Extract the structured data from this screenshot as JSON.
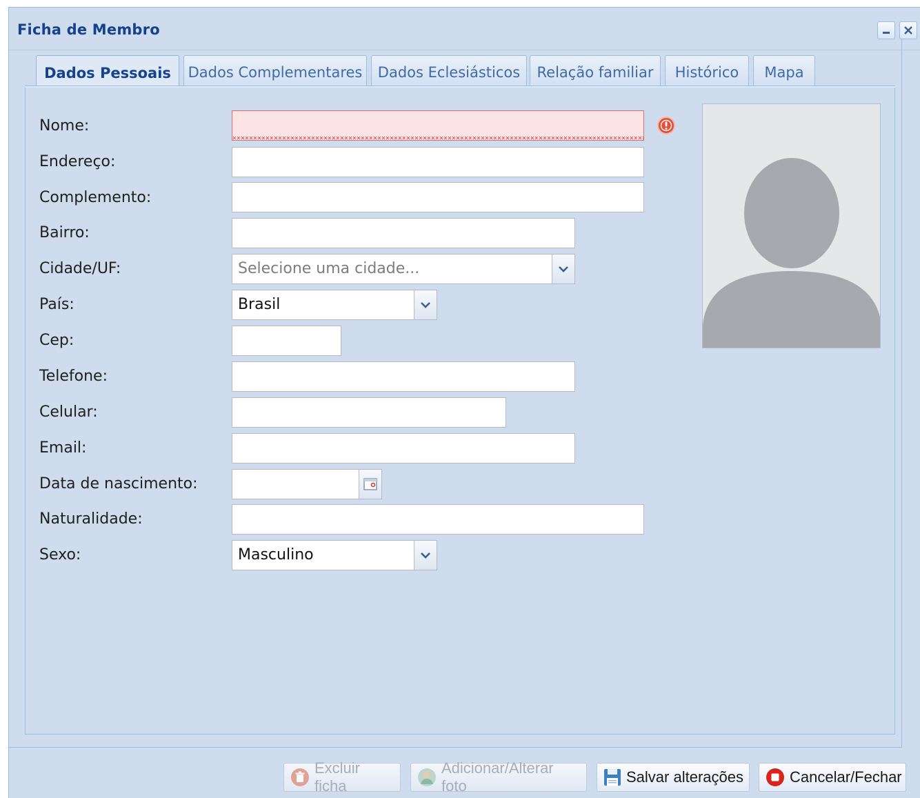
{
  "window": {
    "title": "Ficha de Membro"
  },
  "tabs": [
    {
      "label": "Dados Pessoais",
      "active": true
    },
    {
      "label": "Dados Complementares",
      "active": false
    },
    {
      "label": "Dados Eclesiásticos",
      "active": false
    },
    {
      "label": "Relação familiar",
      "active": false
    },
    {
      "label": "Histórico",
      "active": false
    },
    {
      "label": "Mapa",
      "active": false
    }
  ],
  "form": {
    "nome": {
      "label": "Nome:",
      "value": "",
      "invalid": true
    },
    "endereco": {
      "label": "Endereço:",
      "value": ""
    },
    "complemento": {
      "label": "Complemento:",
      "value": ""
    },
    "bairro": {
      "label": "Bairro:",
      "value": ""
    },
    "cidade": {
      "label": "Cidade/UF:",
      "placeholder": "Selecione uma cidade..."
    },
    "pais": {
      "label": "País:",
      "value": "Brasil"
    },
    "cep": {
      "label": "Cep:",
      "value": ""
    },
    "telefone": {
      "label": "Telefone:",
      "value": ""
    },
    "celular": {
      "label": "Celular:",
      "value": ""
    },
    "email": {
      "label": "Email:",
      "value": ""
    },
    "nascimento": {
      "label": "Data de nascimento:",
      "value": ""
    },
    "naturalidade": {
      "label": "Naturalidade:",
      "value": ""
    },
    "sexo": {
      "label": "Sexo:",
      "value": "Masculino"
    }
  },
  "buttons": {
    "excluir": {
      "label": "Excluir ficha",
      "enabled": false,
      "icon": "trash-icon"
    },
    "foto": {
      "label": "Adicionar/Alterar foto",
      "enabled": false,
      "icon": "user-photo-icon"
    },
    "salvar": {
      "label": "Salvar alterações",
      "enabled": true,
      "icon": "floppy-disk-icon"
    },
    "cancelar": {
      "label": "Cancelar/Fechar",
      "enabled": true,
      "icon": "stop-icon"
    }
  },
  "colors": {
    "window_bg": "#cedced",
    "title": "#15428b",
    "invalid_bg": "#fde5e5",
    "error": "#e0503a",
    "cancel": "#d9241c"
  }
}
